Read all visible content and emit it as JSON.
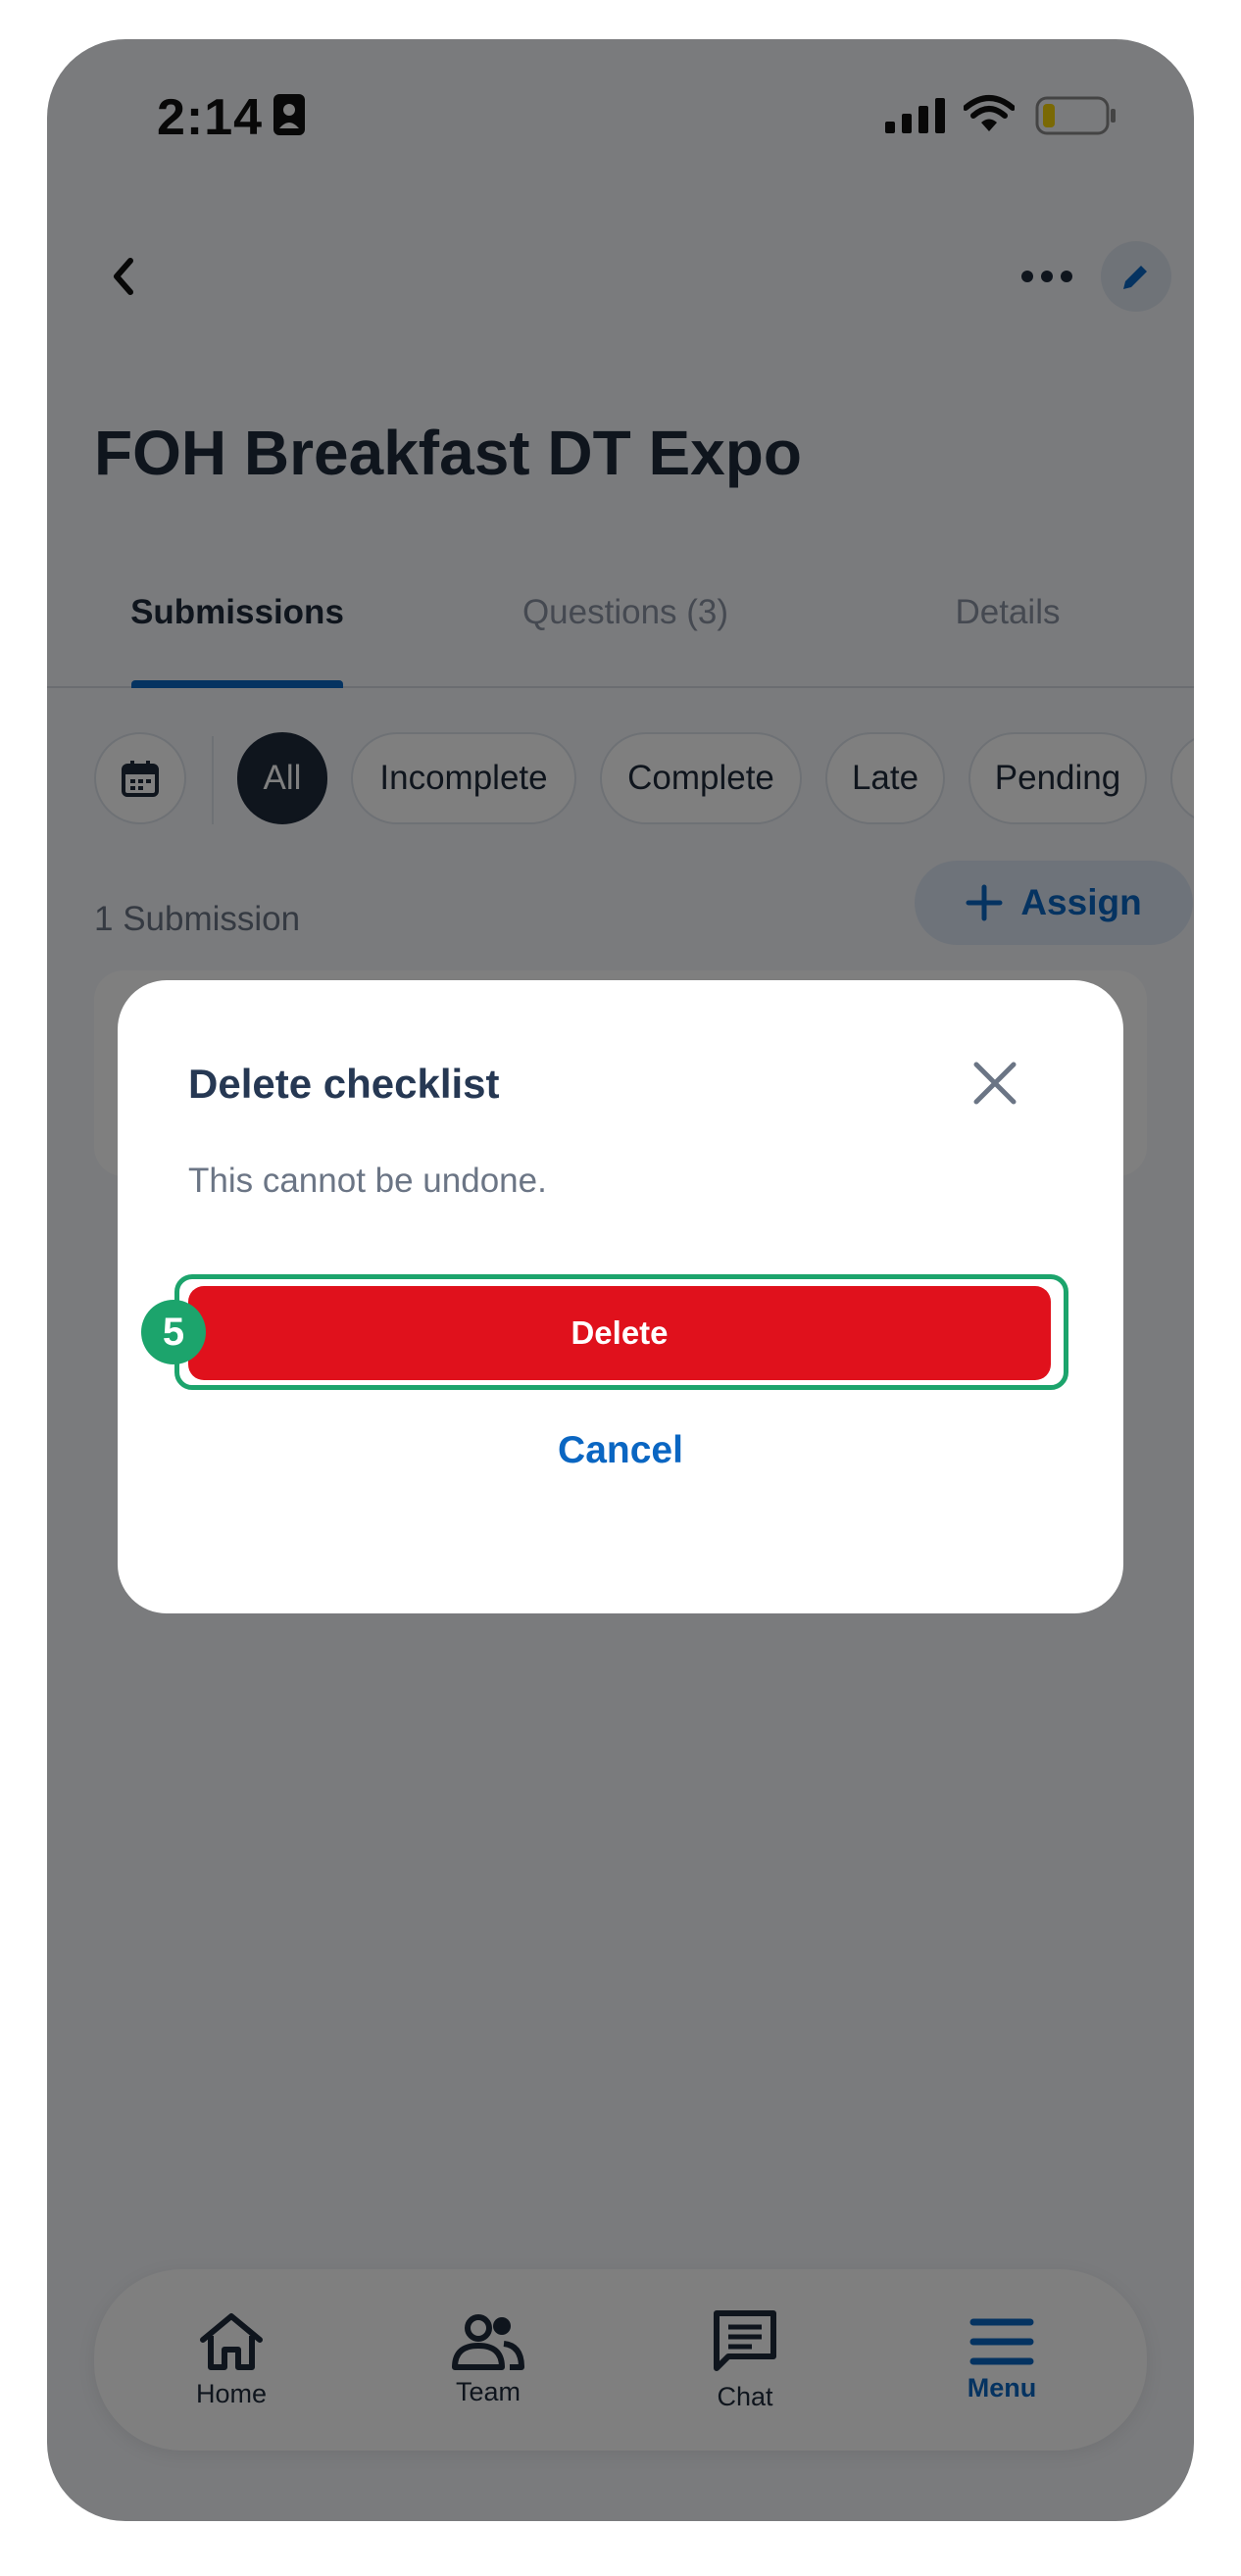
{
  "status_bar": {
    "time": "2:14"
  },
  "header": {
    "title": "FOH Breakfast DT Expo"
  },
  "tabs": [
    {
      "label": "Submissions",
      "active": true
    },
    {
      "label": "Questions (3)",
      "active": false
    },
    {
      "label": "Details",
      "active": false
    }
  ],
  "filters": {
    "chips": [
      "All",
      "Incomplete",
      "Complete",
      "Late",
      "Pending"
    ],
    "selected": "All"
  },
  "submissions": {
    "count_label": "1 Submission",
    "assign_label": "Assign"
  },
  "modal": {
    "title": "Delete checklist",
    "body": "This cannot be undone.",
    "delete_label": "Delete",
    "cancel_label": "Cancel",
    "step_badge": "5"
  },
  "bottom_nav": [
    {
      "label": "Home",
      "icon": "home-icon"
    },
    {
      "label": "Team",
      "icon": "team-icon"
    },
    {
      "label": "Chat",
      "icon": "chat-icon"
    },
    {
      "label": "Menu",
      "icon": "menu-icon",
      "active": true
    }
  ],
  "colors": {
    "accent": "#0a66c2",
    "danger": "#e0111c",
    "highlight": "#1ca46c",
    "text_dark": "#1e2a3b"
  }
}
